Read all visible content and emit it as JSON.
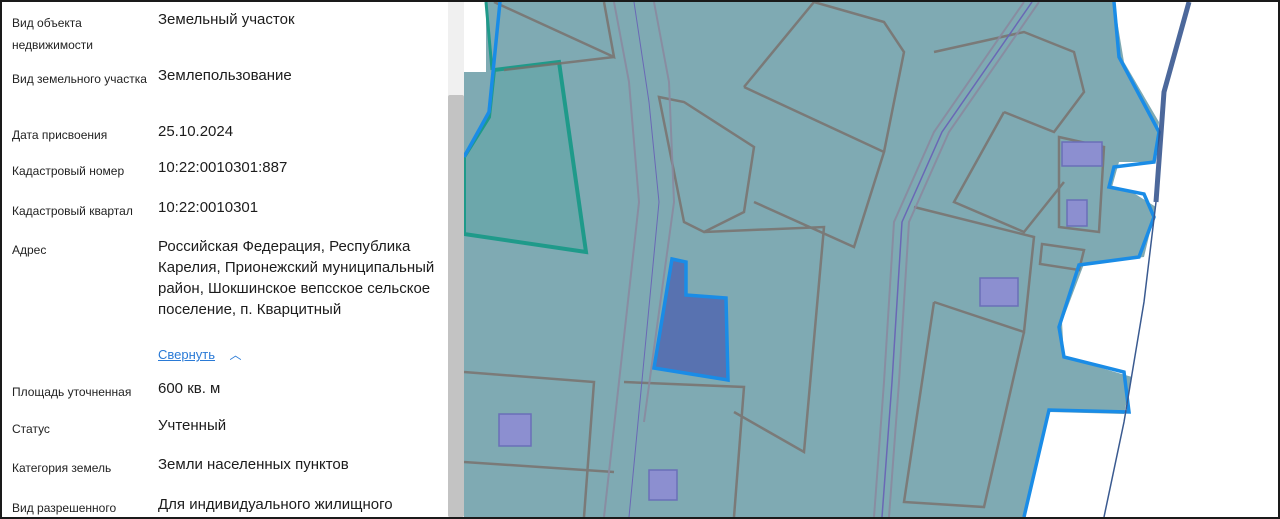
{
  "fields": [
    {
      "label": "Вид объекта недвижимости",
      "value": "Земельный участок"
    },
    {
      "label": "Вид земельного участка",
      "value": "Землепользование"
    },
    {
      "label": "Дата присвоения",
      "value": "25.10.2024"
    },
    {
      "label": "Кадастровый номер",
      "value": "10:22:0010301:887"
    },
    {
      "label": "Кадастровый квартал",
      "value": "10:22:0010301"
    },
    {
      "label": "Адрес",
      "value": "Российская Федерация, Республика Карелия, Прионежский муниципальный район, Шокшинское вепсское сельское поселение, п. Кварцитный"
    },
    {
      "label": "Площадь уточненная",
      "value": "600 кв. м"
    },
    {
      "label": "Статус",
      "value": "Учтенный"
    },
    {
      "label": "Категория земель",
      "value": "Земли населенных пунктов"
    },
    {
      "label": "Вид разрешенного",
      "value": "Для индивидуального жилищного"
    }
  ],
  "collapse_link": "Свернуть",
  "colors": {
    "map_base": "#7faab3",
    "parcel_border": "#7a6f6a",
    "boundary_blue": "#1a8ce6",
    "selected_parcel": "#5872b0",
    "teal_outline": "#1f9a8a",
    "building": "#8c8fd0"
  }
}
